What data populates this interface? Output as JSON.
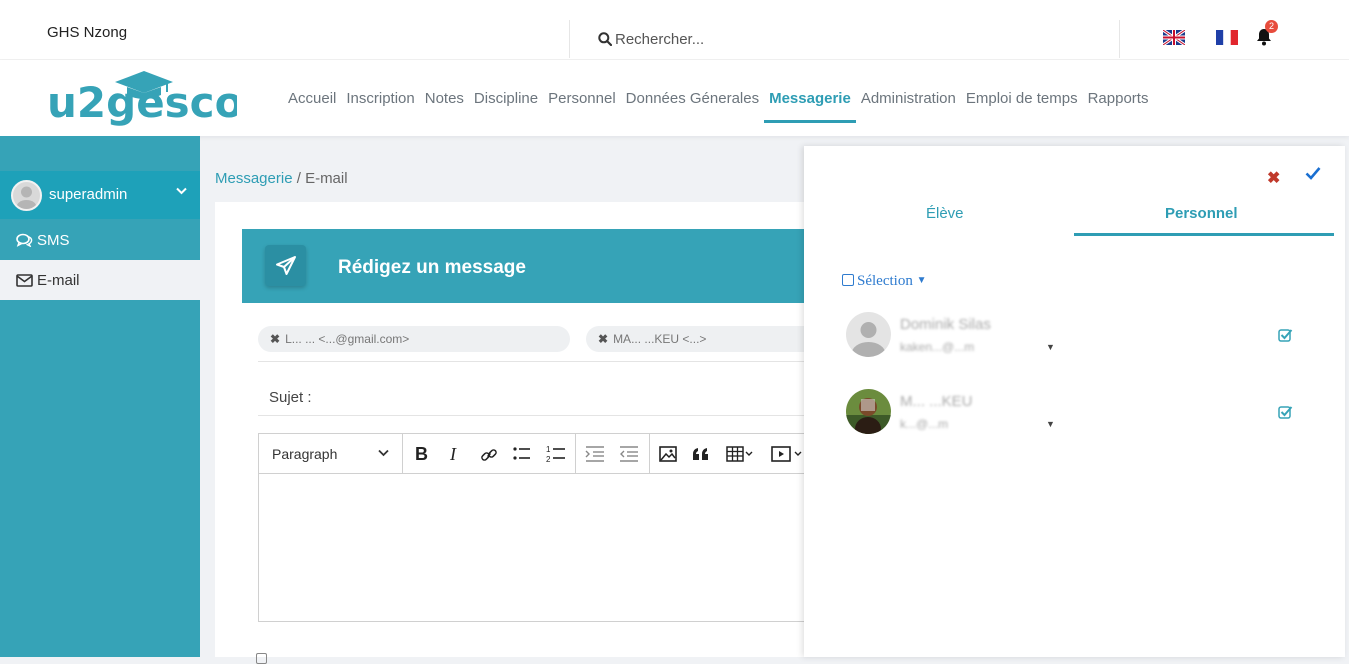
{
  "topbar": {
    "school_name": "GHS Nzong",
    "search_placeholder": "Rechercher...",
    "notification_count": "2",
    "languages": [
      "en-flag-icon",
      "fr-flag-icon"
    ]
  },
  "brand": {
    "logo_text": "u2gesco",
    "color": "#36a3b7"
  },
  "nav": {
    "items": [
      "Accueil",
      "Inscription",
      "Notes",
      "Discipline",
      "Personnel",
      "Données Génerales",
      "Messagerie",
      "Administration",
      "Emploi de temps",
      "Rapports"
    ],
    "active": "Messagerie"
  },
  "sidebar": {
    "username": "superadmin",
    "items": [
      {
        "label": "SMS",
        "icon": "comments-icon"
      },
      {
        "label": "E-mail",
        "icon": "envelope-icon"
      }
    ]
  },
  "breadcrumb": {
    "section": "Messagerie",
    "separator": " / ",
    "page": "E-mail"
  },
  "compose": {
    "title": "Rédigez un message",
    "recipients": [
      "L...  ...  <...@gmail.com>",
      "MA... ...KEU <...>"
    ],
    "subject_label": "Sujet :",
    "editor": {
      "block_format": "Paragraph"
    }
  },
  "panel": {
    "tabs": [
      "Élève",
      "Personnel"
    ],
    "active_tab": "Personnel",
    "selection_label": "Sélection",
    "people": [
      {
        "name": "Dominik Silas",
        "email": "kaken...@...m"
      },
      {
        "name": "M... ...KEU",
        "email": "k...@...m"
      }
    ]
  }
}
